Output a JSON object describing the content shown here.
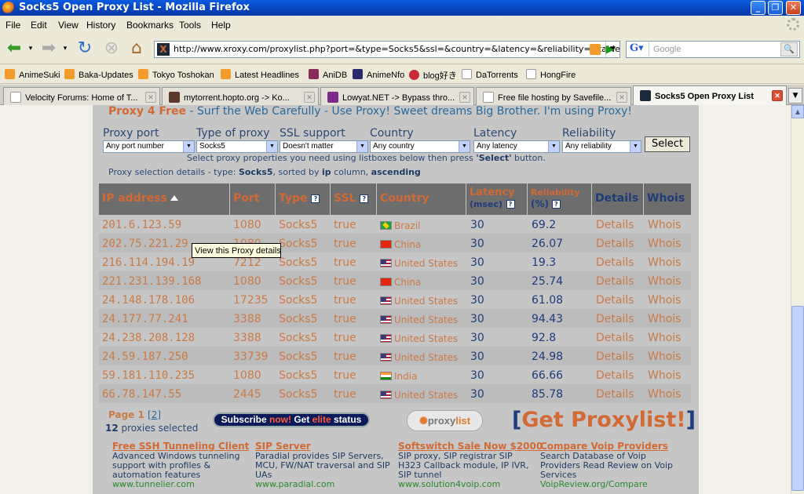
{
  "window": {
    "title": "Socks5 Open Proxy List - Mozilla Firefox"
  },
  "menu": [
    "File",
    "Edit",
    "View",
    "History",
    "Bookmarks",
    "Tools",
    "Help"
  ],
  "url": "http://www.xroxy.com/proxylist.php?port=&type=Socks5&ssl=&country=&latency=&reliability=#table",
  "search": {
    "placeholder": "Google"
  },
  "bookmarks": [
    "AnimeSuki",
    "Baka-Updates",
    "Tokyo Toshokan",
    "Latest Headlines",
    "AniDB",
    "AnimeNfo",
    "blog好き",
    "DaTorrents",
    "HongFire"
  ],
  "tabs": [
    "Velocity Forums: Home of T...",
    "mytorrent.hopto.org -> Ko...",
    "Lowyat.NET -> Bypass thro...",
    "Free file hosting by Savefile...",
    "Socks5 Open Proxy List"
  ],
  "banner": {
    "brand": "Proxy 4 Free",
    "text": " - Surf the Web Carefully - Use Proxy! Sweet dreams Big Brother. I'm using Proxy!"
  },
  "filters": {
    "labels": [
      "Proxy port",
      "Type of proxy",
      "SSL support",
      "Country",
      "Latency",
      "Reliability"
    ],
    "values": [
      "Any port number",
      "Socks5",
      "Doesn't matter",
      "Any country",
      "Any latency",
      "Any reliability"
    ],
    "button": "Select"
  },
  "instructions": {
    "pre": "Select proxy properties you need using listboxes below then press ",
    "bold": "'Select'",
    "post": " button."
  },
  "details": {
    "pre": "Proxy selection details - type: ",
    "type": "Socks5",
    "mid1": ", sorted by ",
    "col": "ip",
    "mid2": " column, ",
    "order": "ascending"
  },
  "table": {
    "headers": {
      "ip": "IP address",
      "port": "Port",
      "type": "Type",
      "ssl": "SSL",
      "country": "Country",
      "latency": "Latency",
      "latency_unit": "(msec)",
      "reliability": "Reliability",
      "reliability_unit": "(%)",
      "details": "Details",
      "whois": "Whois"
    },
    "rows": [
      {
        "ip": "201.6.123.59",
        "port": "1080",
        "type": "Socks5",
        "ssl": "true",
        "flag": "br",
        "country": "Brazil",
        "latency": "30",
        "reliability": "69.2",
        "details": "Details",
        "whois": "Whois"
      },
      {
        "ip": "202.75.221.29",
        "port": "1080",
        "type": "Socks5",
        "ssl": "true",
        "flag": "cn",
        "country": "China",
        "latency": "30",
        "reliability": "26.07",
        "details": "Details",
        "whois": "Whois"
      },
      {
        "ip": "216.114.194.19",
        "port": "7212",
        "type": "Socks5",
        "ssl": "true",
        "flag": "us",
        "country": "United States",
        "latency": "30",
        "reliability": "19.3",
        "details": "Details",
        "whois": "Whois"
      },
      {
        "ip": "221.231.139.168",
        "port": "1080",
        "type": "Socks5",
        "ssl": "true",
        "flag": "cn",
        "country": "China",
        "latency": "30",
        "reliability": "25.74",
        "details": "Details",
        "whois": "Whois"
      },
      {
        "ip": "24.148.178.106",
        "port": "17235",
        "type": "Socks5",
        "ssl": "true",
        "flag": "us",
        "country": "United States",
        "latency": "30",
        "reliability": "61.08",
        "details": "Details",
        "whois": "Whois"
      },
      {
        "ip": "24.177.77.241",
        "port": "3388",
        "type": "Socks5",
        "ssl": "true",
        "flag": "us",
        "country": "United States",
        "latency": "30",
        "reliability": "94.43",
        "details": "Details",
        "whois": "Whois"
      },
      {
        "ip": "24.238.208.128",
        "port": "3388",
        "type": "Socks5",
        "ssl": "true",
        "flag": "us",
        "country": "United States",
        "latency": "30",
        "reliability": "92.8",
        "details": "Details",
        "whois": "Whois"
      },
      {
        "ip": "24.59.187.250",
        "port": "33739",
        "type": "Socks5",
        "ssl": "true",
        "flag": "us",
        "country": "United States",
        "latency": "30",
        "reliability": "24.98",
        "details": "Details",
        "whois": "Whois"
      },
      {
        "ip": "59.181.110.235",
        "port": "1080",
        "type": "Socks5",
        "ssl": "true",
        "flag": "in",
        "country": "India",
        "latency": "30",
        "reliability": "66.66",
        "details": "Details",
        "whois": "Whois"
      },
      {
        "ip": "66.78.147.55",
        "port": "2445",
        "type": "Socks5",
        "ssl": "true",
        "flag": "us",
        "country": "United States",
        "latency": "30",
        "reliability": "85.78",
        "details": "Details",
        "whois": "Whois"
      }
    ]
  },
  "tooltip": "View this Proxy details",
  "pagination": {
    "label": "Page 1",
    "other": "2",
    "count": "12",
    "count_text": " proxies selected"
  },
  "subscribe": {
    "a": "Subscribe ",
    "now": "now!",
    "b": " Get ",
    "elite": "elite",
    "c": " status"
  },
  "logo": {
    "a": "proxy",
    "b": "list"
  },
  "get_proxylist": "Get Proxylist!",
  "ads": [
    {
      "title": "Free SSH Tunneling Client",
      "text": "Advanced Windows tunneling support with profiles & automation features",
      "url": "www.tunnelier.com"
    },
    {
      "title": "SIP Server",
      "text": "Paradial provides SIP Servers, MCU, FW/NAT traversal and SIP UAs",
      "url": "www.paradial.com"
    },
    {
      "title": "Softswitch Sale Now $2000",
      "text": "SIP proxy, SIP registrar SIP H323 Callback module, IP IVR, SIP tunnel",
      "url": "www.solution4voip.com"
    },
    {
      "title": "Compare Voip Providers",
      "text": "Search Database of Voip Providers Read Review on Voip Services",
      "url": "VoipReview.org/Compare"
    }
  ]
}
